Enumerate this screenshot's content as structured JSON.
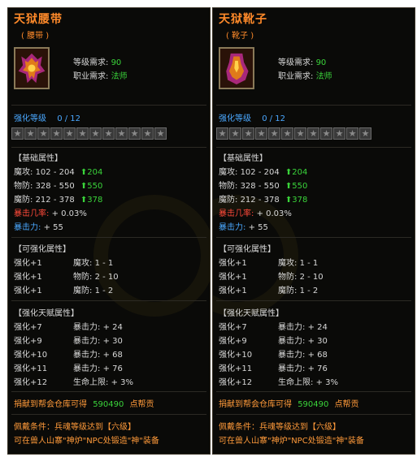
{
  "panels": [
    {
      "title": "天狱腰带",
      "subtitle": "( 腰带 )",
      "icon": "belt-icon",
      "level_req_label": "等级需求:",
      "level_req_value": "90",
      "class_req_label": "职业需求:",
      "class_req_value": "法师",
      "enhance_label": "强化等级",
      "enhance_value": "0 / 12",
      "stars": 12,
      "base_header": "【基础属性】",
      "base": [
        {
          "label": "魔攻:",
          "value": "102 - 204",
          "bonus": "204"
        },
        {
          "label": "物防:",
          "value": "328 - 550",
          "bonus": "550"
        },
        {
          "label": "魔防:",
          "value": "212 - 378",
          "bonus": "378"
        }
      ],
      "crit_rate_label": "暴击几率:",
      "crit_rate_value": "+ 0.03%",
      "crit_power_label": "暴击力:",
      "crit_power_value": "+ 55",
      "enh_header": "【可强化属性】",
      "enh": [
        {
          "lvl": "强化+1",
          "stat": "魔攻:",
          "range": "1 - 1"
        },
        {
          "lvl": "强化+1",
          "stat": "物防:",
          "range": "2 - 10"
        },
        {
          "lvl": "强化+1",
          "stat": "魔防:",
          "range": "1 - 2"
        }
      ],
      "talent_header": "【强化天赋属性】",
      "talent": [
        {
          "lvl": "强化+7",
          "stat": "暴击力:",
          "value": "+ 24"
        },
        {
          "lvl": "强化+9",
          "stat": "暴击力:",
          "value": "+ 30"
        },
        {
          "lvl": "强化+10",
          "stat": "暴击力:",
          "value": "+ 68"
        },
        {
          "lvl": "强化+11",
          "stat": "暴击力:",
          "value": "+ 76"
        },
        {
          "lvl": "强化+12",
          "stat": "生命上限:",
          "value": "+ 3%"
        }
      ],
      "donate_label": "捐献到帮会仓库可得",
      "donate_value": "590490",
      "donate_unit": "点帮贡",
      "wear_cond": "佩戴条件：兵魂等级达到【六级】",
      "forge_note": "可在兽人山寨\"神炉\"NPC处锻造\"神\"装备"
    },
    {
      "title": "天狱靴子",
      "subtitle": "( 靴子 )",
      "icon": "boots-icon",
      "level_req_label": "等级需求:",
      "level_req_value": "90",
      "class_req_label": "职业需求:",
      "class_req_value": "法师",
      "enhance_label": "强化等级",
      "enhance_value": "0 / 12",
      "stars": 12,
      "base_header": "【基础属性】",
      "base": [
        {
          "label": "魔攻:",
          "value": "102 - 204",
          "bonus": "204"
        },
        {
          "label": "物防:",
          "value": "328 - 550",
          "bonus": "550"
        },
        {
          "label": "魔防:",
          "value": "212 - 378",
          "bonus": "378"
        }
      ],
      "crit_rate_label": "暴击几率:",
      "crit_rate_value": "+ 0.03%",
      "crit_power_label": "暴击力:",
      "crit_power_value": "+ 55",
      "enh_header": "【可强化属性】",
      "enh": [
        {
          "lvl": "强化+1",
          "stat": "魔攻:",
          "range": "1 - 1"
        },
        {
          "lvl": "强化+1",
          "stat": "物防:",
          "range": "2 - 10"
        },
        {
          "lvl": "强化+1",
          "stat": "魔防:",
          "range": "1 - 2"
        }
      ],
      "talent_header": "【强化天赋属性】",
      "talent": [
        {
          "lvl": "强化+7",
          "stat": "暴击力:",
          "value": "+ 24"
        },
        {
          "lvl": "强化+9",
          "stat": "暴击力:",
          "value": "+ 30"
        },
        {
          "lvl": "强化+10",
          "stat": "暴击力:",
          "value": "+ 68"
        },
        {
          "lvl": "强化+11",
          "stat": "暴击力:",
          "value": "+ 76"
        },
        {
          "lvl": "强化+12",
          "stat": "生命上限:",
          "value": "+ 3%"
        }
      ],
      "donate_label": "捐献到帮会仓库可得",
      "donate_value": "590490",
      "donate_unit": "点帮贡",
      "wear_cond": "佩戴条件：兵魂等级达到【六级】",
      "forge_note": "可在兽人山寨\"神炉\"NPC处锻造\"神\"装备"
    }
  ]
}
